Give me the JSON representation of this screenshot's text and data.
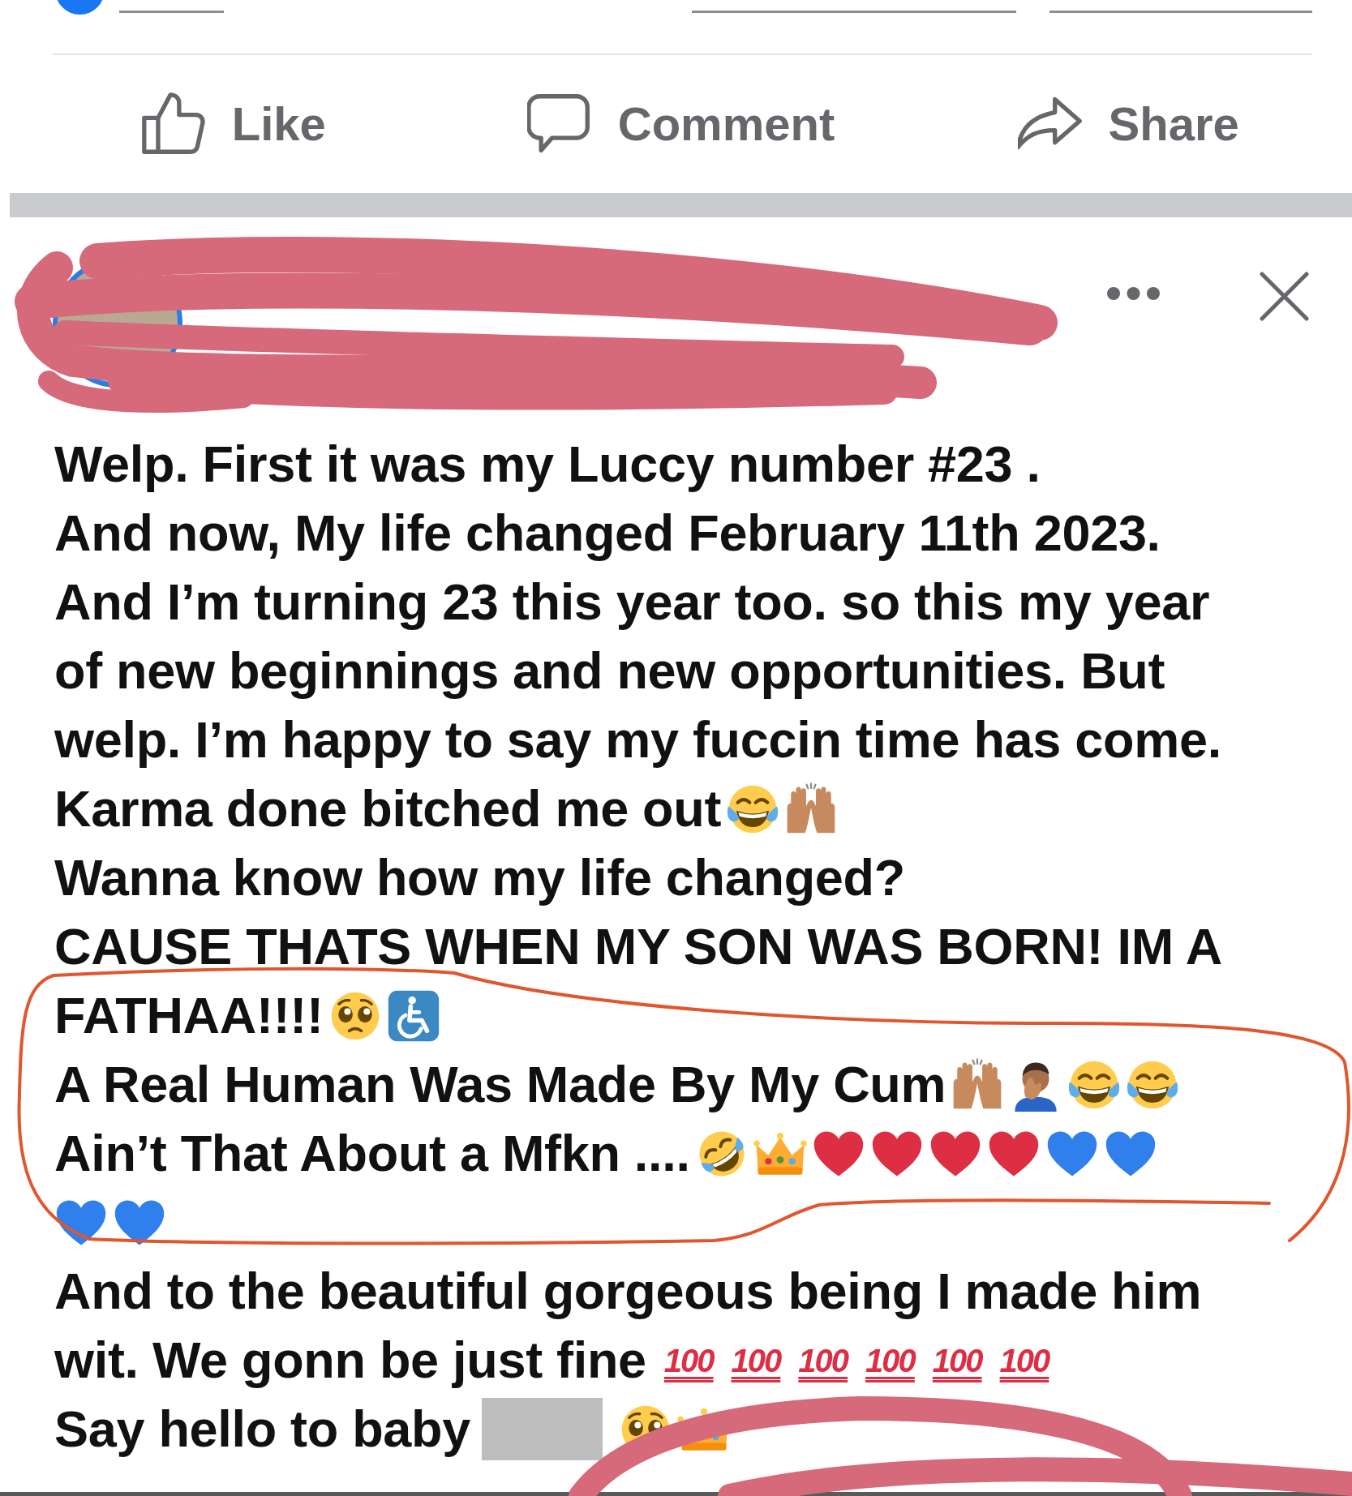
{
  "actions": [
    {
      "kind": "like",
      "label": "Like"
    },
    {
      "kind": "comment",
      "label": "Comment"
    },
    {
      "kind": "share",
      "label": "Share"
    }
  ],
  "post": {
    "lines": [
      {
        "parts": [
          {
            "kind": "text",
            "text": "Welp. First it was my Luccy number #23 ."
          }
        ]
      },
      {
        "parts": [
          {
            "kind": "text",
            "text": "And now, My life changed February 11th 2023."
          }
        ]
      },
      {
        "parts": [
          {
            "kind": "text",
            "text": "And I’m turning 23 this year too. so this my year"
          }
        ]
      },
      {
        "parts": [
          {
            "kind": "text",
            "text": "of new beginnings and new opportunities. But"
          }
        ]
      },
      {
        "parts": [
          {
            "kind": "text",
            "text": "welp. I’m happy to say my fuccin time has come."
          }
        ]
      },
      {
        "parts": [
          {
            "kind": "text",
            "text": "Karma done bitched me out"
          },
          {
            "kind": "joy"
          },
          {
            "kind": "praise"
          }
        ]
      },
      {
        "parts": [
          {
            "kind": "text",
            "text": "Wanna know how my life changed?"
          }
        ]
      },
      {
        "parts": [
          {
            "kind": "text",
            "text": "CAUSE THATS WHEN MY SON WAS BORN! IM A"
          }
        ]
      },
      {
        "parts": [
          {
            "kind": "text",
            "text": "FATHAA!!!!"
          },
          {
            "kind": "pleading"
          },
          {
            "kind": "wheelchair"
          }
        ]
      },
      {
        "parts": [
          {
            "kind": "text",
            "text": "A Real Human Was Made By My Cum"
          },
          {
            "kind": "praise"
          },
          {
            "kind": "facepalm"
          },
          {
            "kind": "joy"
          },
          {
            "kind": "joy"
          }
        ]
      },
      {
        "parts": [
          {
            "kind": "text",
            "text": "Ain’t That About a Mfkn ...."
          },
          {
            "kind": "rofl"
          },
          {
            "kind": "crown"
          },
          {
            "kind": "heart",
            "color": "#dd2e44"
          },
          {
            "kind": "heart",
            "color": "#dd2e44"
          },
          {
            "kind": "heart",
            "color": "#dd2e44"
          },
          {
            "kind": "heart",
            "color": "#dd2e44"
          },
          {
            "kind": "heart",
            "color": "#2f80ed"
          },
          {
            "kind": "heart",
            "color": "#2f80ed"
          }
        ]
      },
      {
        "parts": [
          {
            "kind": "heart",
            "color": "#2f80ed"
          },
          {
            "kind": "heart",
            "color": "#2f80ed"
          }
        ]
      },
      {
        "parts": [
          {
            "kind": "text",
            "text": "And to the beautiful gorgeous being I made him"
          }
        ]
      },
      {
        "parts": [
          {
            "kind": "text",
            "text": "wit. We gonn be just fine"
          },
          {
            "kind": "hundred",
            "text": "100"
          },
          {
            "kind": "hundred",
            "text": "100"
          },
          {
            "kind": "hundred",
            "text": "100"
          },
          {
            "kind": "hundred",
            "text": "100"
          },
          {
            "kind": "hundred",
            "text": "100"
          },
          {
            "kind": "hundred",
            "text": "100"
          }
        ]
      },
      {
        "parts": [
          {
            "kind": "text",
            "text": "Say hello to baby"
          },
          {
            "kind": "redacted"
          },
          {
            "kind": "pleading"
          },
          {
            "kind": "crown"
          }
        ]
      }
    ]
  }
}
